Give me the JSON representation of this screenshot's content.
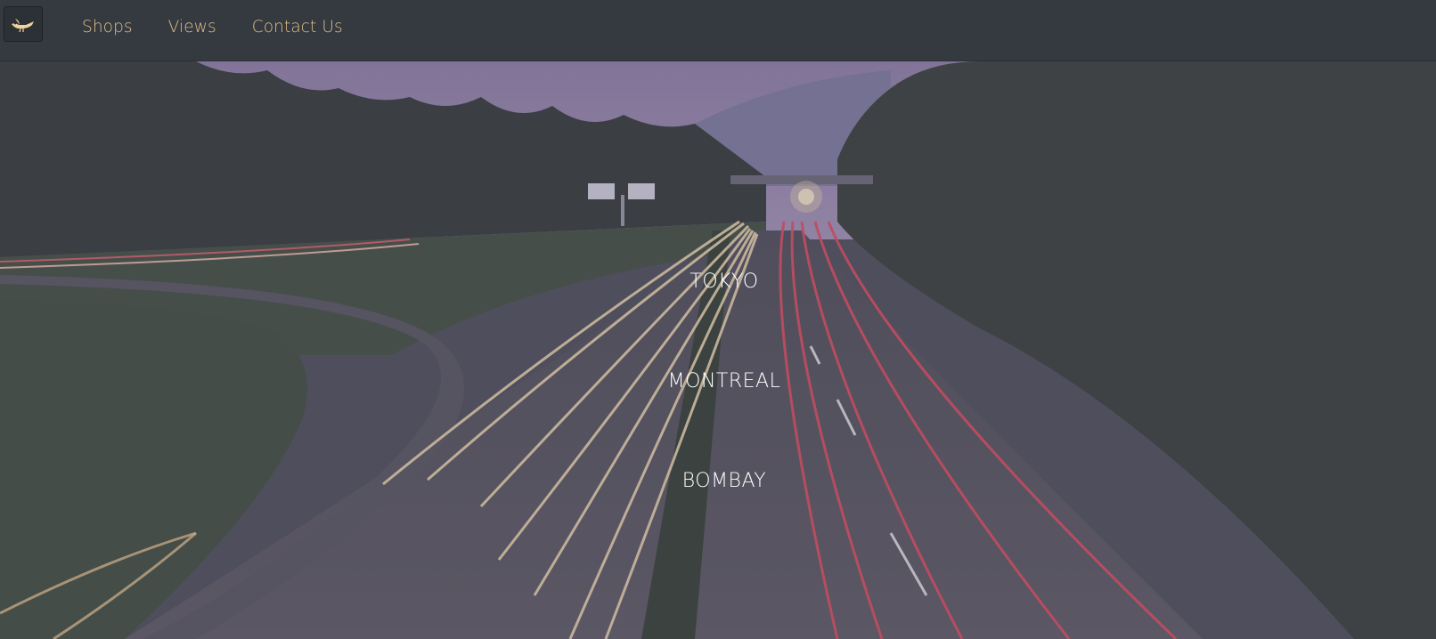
{
  "navbar": {
    "brand_icon": "bird-icon",
    "links": [
      "Shops",
      "Views",
      "Contact Us"
    ],
    "link_color": "#e0bd8a",
    "background": "#343a40"
  },
  "hero": {
    "image": "highway-light-trails-at-dusk",
    "cities": [
      "TOKYO",
      "MONTREAL",
      "BOMBAY"
    ]
  }
}
